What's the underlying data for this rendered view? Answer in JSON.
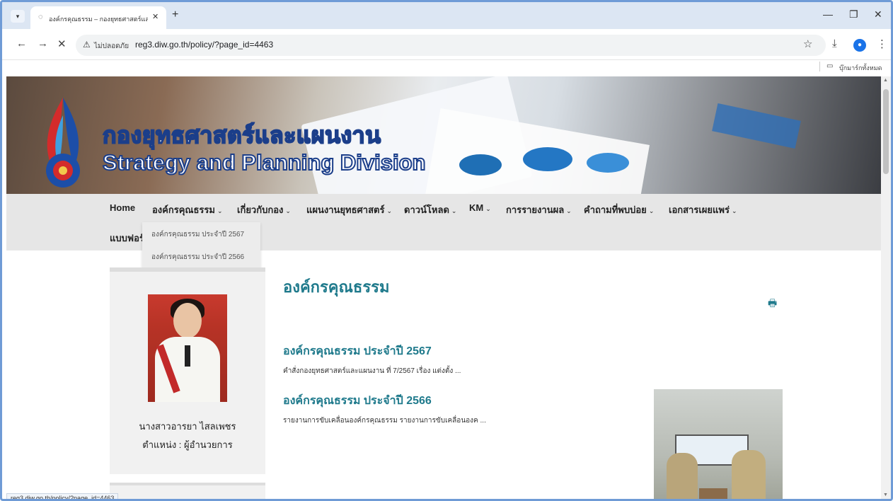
{
  "browser": {
    "tab_title": "องค์กรคุณธรรม – กองยุทธศาสตร์และ",
    "url": "reg3.diw.go.th/policy/?page_id=4463",
    "security_text": "ไม่ปลอดภัย",
    "bookmarks_folder": "บุ๊กมาร์กทั้งหมด",
    "status_url": "reg3.diw.go.th/policy/?page_id=4463"
  },
  "banner": {
    "title_th": "กองยุทธศาสตร์และแผนงาน",
    "title_en": "Strategy and Planning Division"
  },
  "nav": {
    "items": [
      {
        "label": "Home"
      },
      {
        "label": "องค์กรคุณธรรม"
      },
      {
        "label": "เกี่ยวกับกอง"
      },
      {
        "label": "แผนงานยุทธศาสตร์"
      },
      {
        "label": "ดาวน์โหลด"
      },
      {
        "label": "KM"
      },
      {
        "label": "การรายงานผล"
      },
      {
        "label": "คำถามที่พบบ่อย"
      },
      {
        "label": "เอกสารเผยแพร่"
      },
      {
        "label": "แบบฟอร์"
      }
    ],
    "dropdown": [
      {
        "label": "องค์กรคุณธรรม ประจำปี 2567"
      },
      {
        "label": "องค์กรคุณธรรม ประจำปี 2566"
      }
    ]
  },
  "sidebar": {
    "name": "นางสาวอารยา ไสลเพชร",
    "position": "ตำแหน่ง : ผู้อำนวยการ"
  },
  "main": {
    "title": "องค์กรคุณธรรม",
    "posts": [
      {
        "title": "องค์กรคุณธรรม ประจำปี 2567",
        "excerpt": "คำสั่งกองยุทธศาสตร์และแผนงาน ที่ 7/2567 เรื่อง แต่งตั้ง ..."
      },
      {
        "title": "องค์กรคุณธรรม ประจำปี 2566",
        "excerpt": "รายงานการขับเคลื่อนองค์กรคุณธรรม รายงานการขับเคลื่อนองค ..."
      }
    ]
  },
  "colors": {
    "accent": "#1f7a8c",
    "nav_bg": "#e6e6e6",
    "frame": "#6f9bd6"
  }
}
